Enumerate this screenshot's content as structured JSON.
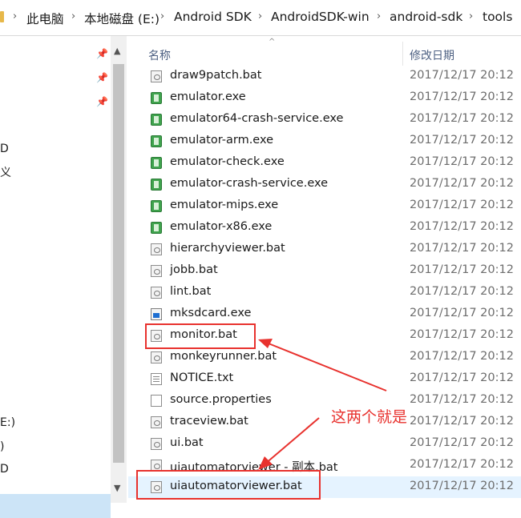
{
  "breadcrumb": {
    "items": [
      "此电脑",
      "本地磁盘 (E:)",
      "Android SDK",
      "AndroidSDK-win",
      "android-sdk",
      "tools"
    ],
    "separator": "›"
  },
  "nav_pane": {
    "fragments": [
      "D",
      "义",
      "E:)",
      ")",
      "D"
    ],
    "pin_count": 3
  },
  "columns": {
    "name": "名称",
    "date_modified": "修改日期"
  },
  "files": [
    {
      "name": "draw9patch.bat",
      "date": "2017/12/17 20:12",
      "icon": "bat-icon"
    },
    {
      "name": "emulator.exe",
      "date": "2017/12/17 20:12",
      "icon": "emulator-exe-icon"
    },
    {
      "name": "emulator64-crash-service.exe",
      "date": "2017/12/17 20:12",
      "icon": "emulator-exe-icon"
    },
    {
      "name": "emulator-arm.exe",
      "date": "2017/12/17 20:12",
      "icon": "emulator-exe-icon"
    },
    {
      "name": "emulator-check.exe",
      "date": "2017/12/17 20:12",
      "icon": "emulator-exe-icon"
    },
    {
      "name": "emulator-crash-service.exe",
      "date": "2017/12/17 20:12",
      "icon": "emulator-exe-icon"
    },
    {
      "name": "emulator-mips.exe",
      "date": "2017/12/17 20:12",
      "icon": "emulator-exe-icon"
    },
    {
      "name": "emulator-x86.exe",
      "date": "2017/12/17 20:12",
      "icon": "emulator-exe-icon"
    },
    {
      "name": "hierarchyviewer.bat",
      "date": "2017/12/17 20:12",
      "icon": "bat-icon"
    },
    {
      "name": "jobb.bat",
      "date": "2017/12/17 20:12",
      "icon": "bat-icon"
    },
    {
      "name": "lint.bat",
      "date": "2017/12/17 20:12",
      "icon": "bat-icon"
    },
    {
      "name": "mksdcard.exe",
      "date": "2017/12/17 20:12",
      "icon": "app-exe-icon"
    },
    {
      "name": "monitor.bat",
      "date": "2017/12/17 20:12",
      "icon": "bat-icon"
    },
    {
      "name": "monkeyrunner.bat",
      "date": "2017/12/17 20:12",
      "icon": "bat-icon"
    },
    {
      "name": "NOTICE.txt",
      "date": "2017/12/17 20:12",
      "icon": "text-file-icon"
    },
    {
      "name": "source.properties",
      "date": "2017/12/17 20:12",
      "icon": "file-icon"
    },
    {
      "name": "traceview.bat",
      "date": "2017/12/17 20:12",
      "icon": "bat-icon"
    },
    {
      "name": "ui.bat",
      "date": "2017/12/17 20:12",
      "icon": "bat-icon"
    },
    {
      "name": "uiautomatorviewer - 副本.bat",
      "date": "2017/12/17 20:12",
      "icon": "bat-icon"
    },
    {
      "name": "uiautomatorviewer.bat",
      "date": "2017/12/17 20:12",
      "icon": "bat-icon",
      "selected": true
    }
  ],
  "annotation": {
    "text": "这两个就是",
    "color": "#e8322e"
  },
  "colors": {
    "selection": "#e5f3ff",
    "nav_selection": "#cce4f7",
    "column_header": "#4d6082",
    "annotation": "#e8322e"
  }
}
